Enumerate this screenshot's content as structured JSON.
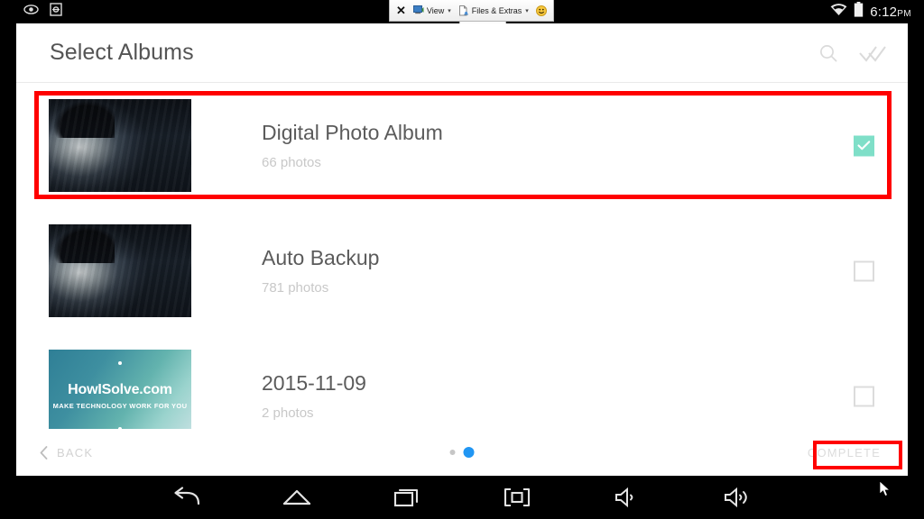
{
  "status_bar": {
    "left_icons": [
      "eye-icon",
      "adb-icon"
    ],
    "right_icons": [
      "wifi-icon",
      "battery-icon"
    ],
    "time": "6:12",
    "ampm": "PM"
  },
  "vnc_toolbar": {
    "close_label": "✕",
    "items": [
      {
        "icon": "monitor-icon",
        "label": "View",
        "caret": "▾"
      },
      {
        "icon": "files-icon",
        "label": "Files & Extras",
        "caret": "▾"
      },
      {
        "icon": "smiley-icon",
        "label": ""
      }
    ],
    "subbar": {
      "keyboard_label": "⌨",
      "minimize_label": "—",
      "collapse_label": "∧"
    }
  },
  "app": {
    "header": {
      "title": "Select Albums",
      "actions": [
        {
          "name": "search-icon",
          "label": "Search"
        },
        {
          "name": "select-all-icon",
          "label": "Select all"
        }
      ]
    },
    "albums": [
      {
        "name": "Digital Photo Album",
        "count": "66 photos",
        "thumbnail": "dark-portrait-thumbnail",
        "checked": true,
        "highlighted": true
      },
      {
        "name": "Auto Backup",
        "count": "781 photos",
        "thumbnail": "dark-portrait-thumbnail",
        "checked": false,
        "highlighted": false
      },
      {
        "name": "2015-11-09",
        "count": "2 photos",
        "thumbnail": "howisolve-banner-thumbnail",
        "thumbnail_text": {
          "main": "HowISolve.com",
          "sub": "MAKE TECHNOLOGY WORK FOR YOU"
        },
        "checked": false,
        "highlighted": false
      }
    ],
    "footer": {
      "back_label": "BACK",
      "complete_label": "COMPLETE",
      "page_dots": {
        "total": 2,
        "active_index": 1
      }
    }
  },
  "nav_bar": {
    "buttons": [
      {
        "name": "nav-back-icon",
        "label": "Back"
      },
      {
        "name": "nav-home-icon",
        "label": "Home"
      },
      {
        "name": "nav-recents-icon",
        "label": "Recent apps"
      },
      {
        "name": "nav-fullscreen-icon",
        "label": "Fullscreen"
      },
      {
        "name": "nav-volume-down-icon",
        "label": "Volume down"
      },
      {
        "name": "nav-volume-up-icon",
        "label": "Volume up"
      }
    ]
  },
  "annotations": {
    "accent_color": "#ff0000",
    "boxes": [
      "first-album-row",
      "complete-button"
    ]
  },
  "colors": {
    "checkbox_checked": "#7fdfc8",
    "page_dot_active": "#2196f3",
    "annotation_red": "#ff0000",
    "title_text": "#545454"
  }
}
